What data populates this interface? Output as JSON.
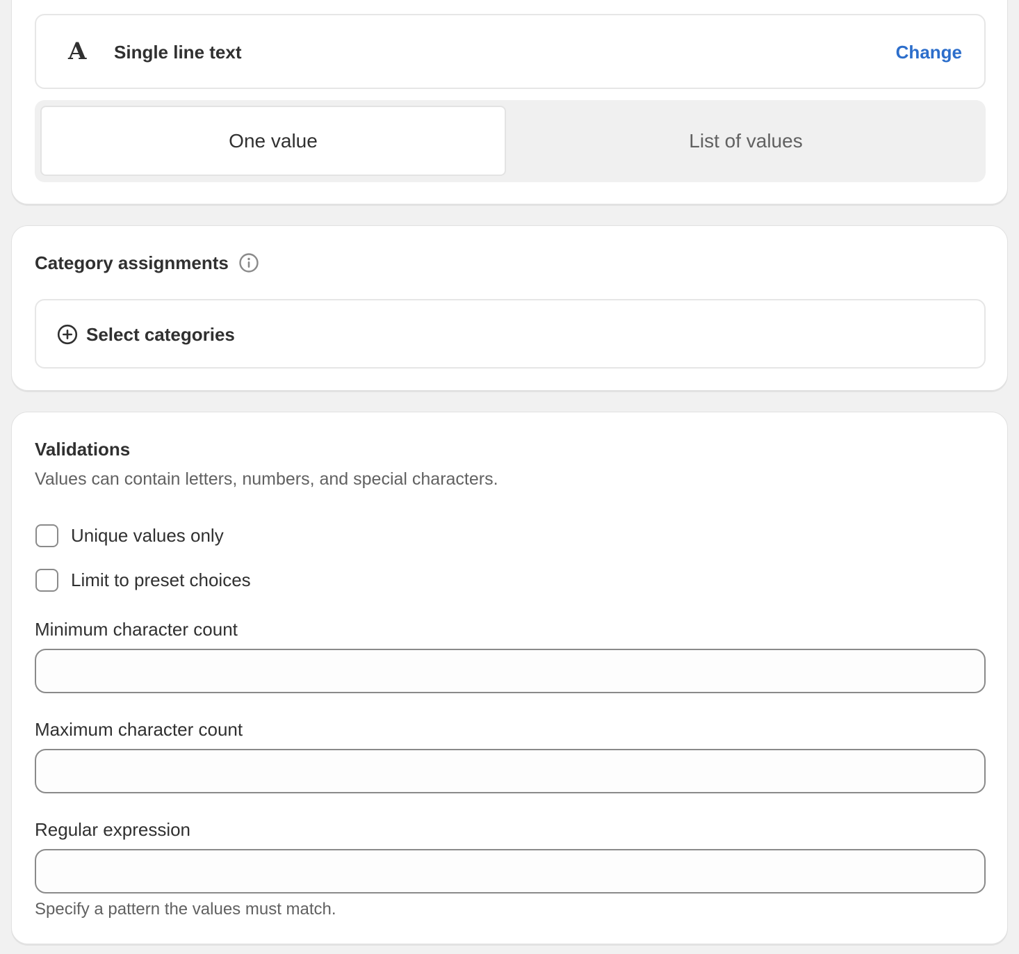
{
  "type_section": {
    "icon": "letter-a-icon",
    "type_label": "Single line text",
    "change_label": "Change",
    "toggle": {
      "options": [
        "One value",
        "List of values"
      ],
      "selected": "One value"
    }
  },
  "category_section": {
    "title": "Category assignments",
    "info_icon": "info-circle-icon",
    "select_label": "Select categories",
    "select_icon": "plus-circle-icon"
  },
  "validations": {
    "title": "Validations",
    "description": "Values can contain letters, numbers, and special characters.",
    "checkboxes": [
      {
        "label": "Unique values only",
        "checked": false
      },
      {
        "label": "Limit to preset choices",
        "checked": false
      }
    ],
    "fields": [
      {
        "label": "Minimum character count",
        "value": "",
        "placeholder": ""
      },
      {
        "label": "Maximum character count",
        "value": "",
        "placeholder": ""
      },
      {
        "label": "Regular expression",
        "value": "",
        "placeholder": ""
      }
    ],
    "regex_help": "Specify a pattern the values must match."
  },
  "colors": {
    "accent_link": "#2c6ecb",
    "page_bg": "#f1f1f1",
    "card_bg": "#ffffff",
    "text_primary": "#303030",
    "text_secondary": "#616161"
  }
}
